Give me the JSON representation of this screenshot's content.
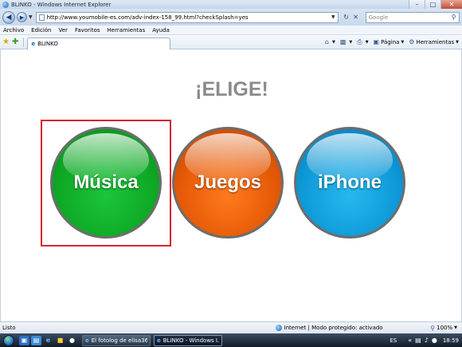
{
  "window": {
    "title": "BLINKO - Windows Internet Explorer",
    "minimize_icon": "minimize-icon",
    "maximize_icon": "maximize-icon",
    "close_icon": "close-icon"
  },
  "address_bar": {
    "url": "http://www.youmobile-es.com/adv-index-158_99.html?checkSplash=yes",
    "search_placeholder": "Google"
  },
  "menu": [
    "Archivo",
    "Edición",
    "Ver",
    "Favoritos",
    "Herramientas",
    "Ayuda"
  ],
  "tab": {
    "label": "BLINKO"
  },
  "commands": {
    "page_label": "Página",
    "tools_label": "Herramientas"
  },
  "content": {
    "heading": "¡ELIGE!",
    "options": [
      {
        "label": "Música",
        "color": "#11b02b"
      },
      {
        "label": "Juegos",
        "color": "#e85e0c"
      },
      {
        "label": "iPhone",
        "color": "#1aa5e2"
      }
    ],
    "selection_color": "#d5262b"
  },
  "status": {
    "text": "Listo",
    "zone": "Internet | Modo protegido: activado",
    "zoom": "100%"
  },
  "taskbar": {
    "buttons": [
      {
        "label": "El fotolog de elisa36..."
      },
      {
        "label": "BLINKO - Windows I..."
      }
    ],
    "language": "ES",
    "clock": "18:59"
  }
}
